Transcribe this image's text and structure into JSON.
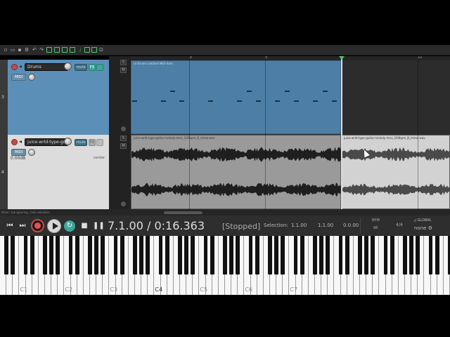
{
  "toolbar": {
    "icons": [
      "new-file-icon",
      "open-icon",
      "save-icon",
      "settings-icon",
      "undo-icon",
      "redo-icon",
      "grid-icon",
      "snap-icon",
      "ripple-icon",
      "lock-icon",
      "metronome-icon",
      "group-icon",
      "envelope-icon"
    ]
  },
  "tracks": [
    {
      "number": "3",
      "name": "Drums",
      "route_label": "route",
      "fx_label": "FX",
      "io_label": "MIDI",
      "volume": "",
      "pan": ""
    },
    {
      "number": "4",
      "name": "juice-wrld-type-guitar-",
      "route_label": "route",
      "fx_label": "FX",
      "io_label": "MIDI",
      "volume": "0.00dB",
      "pan": "center"
    }
  ],
  "items": {
    "midi_title": "ra-Drums untitled MIDI item",
    "audio_a_title": "juice-wrld-type-guitar-melody-miss_164bpm_B_minor.wav",
    "audio_b_title": "juice-wrld-type-guitar-melody-miss_164bpm_B_minor.wav"
  },
  "ruler": {
    "labels": [
      "8",
      "9",
      "10"
    ]
  },
  "status": {
    "text": "Mixer: tab ignoring, click selection"
  },
  "transport": {
    "time": "7.1.00 / 0:16.363",
    "state": "[Stopped]",
    "selection_label": "Selection:",
    "selection_start": "1.1.00",
    "selection_end": "1.1.00",
    "selection_length": "0.0.00",
    "bpm_label": "BPM",
    "bpm_value": "88",
    "time_signature": "4/4",
    "global_label": "GLOBAL",
    "global_value": "none"
  },
  "keyboard": {
    "labels": [
      "C1",
      "C2",
      "C3",
      "C4",
      "C5",
      "C6",
      "C7"
    ]
  },
  "colors": {
    "midi_item": "#4d7fa6",
    "accent_green": "#4fc86f",
    "record": "#e25252",
    "teal": "#3aa89a"
  }
}
